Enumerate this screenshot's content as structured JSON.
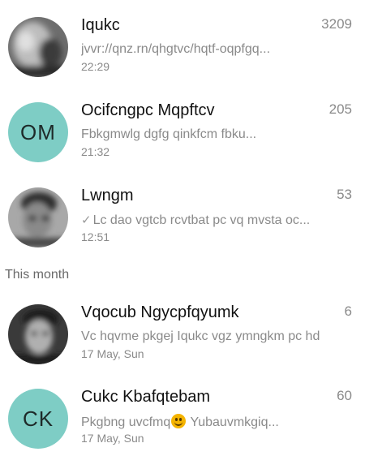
{
  "section_header": "This month",
  "chats": [
    {
      "name": "Iqukc",
      "preview": "jvvr://qnz.rn/qhgtvc/hqtf-oqpfgq...",
      "time": "22:29",
      "count": "3209",
      "avatar": {
        "type": "photo"
      }
    },
    {
      "name": "Ocifcngpc Mqpftcv",
      "preview": "Fbkgmwlg dgfg qinkfcm fbku...",
      "time": "21:32",
      "count": "205",
      "avatar": {
        "type": "initials",
        "text": "OM",
        "color": "#7ecdc5"
      }
    },
    {
      "name": "Lwngm",
      "preview": "Lc dao vgtcb rcvtbat pc vq mvsta oc...",
      "time": "12:51",
      "count": "53",
      "avatar": {
        "type": "photo"
      },
      "read_check": "✓"
    },
    {
      "name": "Vqocub Ngycpfqyumk",
      "preview": "Vc hqvme pkgej Iqukc vgz ymngkm pc hd",
      "time": "17 May, Sun",
      "count": "6",
      "avatar": {
        "type": "photo"
      }
    },
    {
      "name": "Cukc Kbafqtebam",
      "preview_before_emoji": "Pkgbng uvcfmq",
      "preview_after_emoji": " Yubauvmkgiq...",
      "emoji_icon": "smiley-emoji-icon",
      "time": "17 May, Sun",
      "count": "60",
      "avatar": {
        "type": "initials",
        "text": "CK",
        "color": "#7ecdc5"
      }
    }
  ]
}
